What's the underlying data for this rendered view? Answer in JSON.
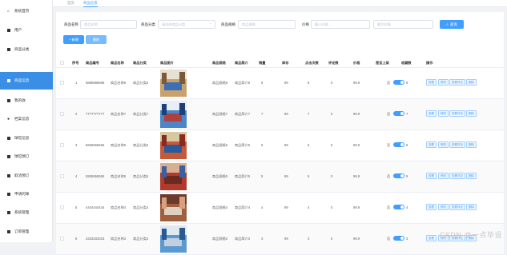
{
  "sidebar": {
    "items": [
      {
        "label": "系统首页",
        "icon": "home-icon"
      },
      {
        "label": "用户",
        "icon": "user-icon"
      },
      {
        "label": "商品分类",
        "icon": "grid-icon"
      },
      {
        "label": "商品信息",
        "icon": "grid-icon"
      },
      {
        "label": "我的收",
        "icon": "user-icon"
      },
      {
        "label": "档案信息",
        "icon": "location-icon"
      },
      {
        "label": "球馆信息",
        "icon": "grid-icon"
      },
      {
        "label": "球馆预订",
        "icon": "grid-icon"
      },
      {
        "label": "取消预订",
        "icon": "grid-icon"
      },
      {
        "label": "申请的球",
        "icon": "grid-icon"
      },
      {
        "label": "系统管理",
        "icon": "grid-icon"
      },
      {
        "label": "订单管理",
        "icon": "grid-icon"
      }
    ],
    "active_index": 3,
    "accent": "#3a8ee6"
  },
  "tabs": [
    {
      "label": "首页"
    },
    {
      "label": "商品信息"
    }
  ],
  "search": {
    "name_label": "商品名称",
    "name_placeholder": "商品名称",
    "category_label": "商品分类",
    "category_placeholder": "请选择商品分类",
    "spec_label": "商品规格",
    "spec_placeholder": "商品规格",
    "price_label": "价格",
    "price_min_placeholder": "最小价格",
    "price_max_placeholder": "最大价格",
    "query_label": "查询"
  },
  "toolbar": {
    "add_label": "+ 新增",
    "delete_label": "删除"
  },
  "table": {
    "headers": [
      "序号",
      "商品编号",
      "商品名称",
      "商品分类",
      "商品图片",
      "商品规格",
      "商品简介",
      "销量",
      "库存",
      "点击次数",
      "评论数",
      "价格",
      "是否上架",
      "收藏数",
      "操作"
    ],
    "rows": [
      {
        "index": "1",
        "code": "8888888888",
        "name": "商品名称8",
        "category": "商品分类8",
        "spec": "商品规格8",
        "intro": "商品简介8",
        "sales": "8",
        "stock": "99",
        "clicks": "8",
        "comments": "0",
        "price": "99.9",
        "onsale_prefix": "否",
        "favorites": "8"
      },
      {
        "index": "2",
        "code": "7777777777",
        "name": "商品名称7",
        "category": "商品分类7",
        "spec": "商品规格7",
        "intro": "商品简介7",
        "sales": "7",
        "stock": "99",
        "clicks": "7",
        "comments": "0",
        "price": "99.9",
        "onsale_prefix": "否",
        "favorites": "7"
      },
      {
        "index": "3",
        "code": "6666666666",
        "name": "商品名称6",
        "category": "商品分类6",
        "spec": "商品规格6",
        "intro": "商品简介6",
        "sales": "6",
        "stock": "99",
        "clicks": "6",
        "comments": "0",
        "price": "99.9",
        "onsale_prefix": "否",
        "favorites": "6"
      },
      {
        "index": "4",
        "code": "5555555555",
        "name": "商品名称5",
        "category": "商品分类5",
        "spec": "商品规格5",
        "intro": "商品简介5",
        "sales": "5",
        "stock": "99",
        "clicks": "5",
        "comments": "0",
        "price": "99.9",
        "onsale_prefix": "否",
        "favorites": "5"
      },
      {
        "index": "5",
        "code": "4444444444",
        "name": "商品名称4",
        "category": "商品分类4",
        "spec": "商品规格4",
        "intro": "商品简介4",
        "sales": "4",
        "stock": "99",
        "clicks": "4",
        "comments": "0",
        "price": "99.9",
        "onsale_prefix": "否",
        "favorites": "4"
      },
      {
        "index": "6",
        "code": "3333333333",
        "name": "商品名称3",
        "category": "商品分类3",
        "spec": "商品规格3",
        "intro": "商品简介3",
        "sales": "3",
        "stock": "99",
        "clicks": "3",
        "comments": "0",
        "price": "99.9",
        "onsale_prefix": "否",
        "favorites": "3"
      }
    ],
    "actions": [
      "查看",
      "修改",
      "查看评论",
      "删除"
    ]
  },
  "watermark": "CSDN @一点毕设",
  "colors": {
    "primary": "#409eff",
    "active_sidebar": "#3a8ee6"
  }
}
